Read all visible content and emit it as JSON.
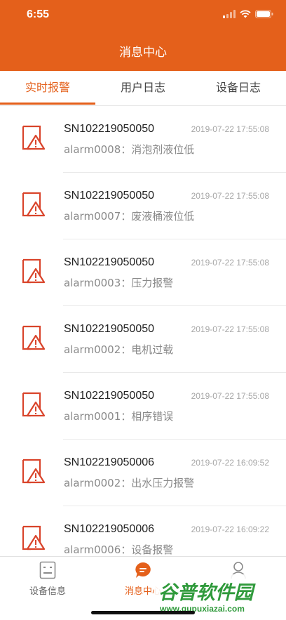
{
  "status": {
    "time": "6:55"
  },
  "nav": {
    "title": "消息中心"
  },
  "tabs": [
    {
      "label": "实时报警",
      "active": true
    },
    {
      "label": "用户日志",
      "active": false
    },
    {
      "label": "设备日志",
      "active": false
    }
  ],
  "alarms": [
    {
      "sn": "SN102219050050",
      "time": "2019-07-22 17:55:08",
      "message": "alarm0008：消泡剂液位低"
    },
    {
      "sn": "SN102219050050",
      "time": "2019-07-22 17:55:08",
      "message": "alarm0007：废液桶液位低"
    },
    {
      "sn": "SN102219050050",
      "time": "2019-07-22 17:55:08",
      "message": "alarm0003：压力报警"
    },
    {
      "sn": "SN102219050050",
      "time": "2019-07-22 17:55:08",
      "message": "alarm0002：电机过载"
    },
    {
      "sn": "SN102219050050",
      "time": "2019-07-22 17:55:08",
      "message": "alarm0001：相序错误"
    },
    {
      "sn": "SN102219050006",
      "time": "2019-07-22 16:09:52",
      "message": "alarm0002：出水压力报警"
    },
    {
      "sn": "SN102219050006",
      "time": "2019-07-22 16:09:22",
      "message": "alarm0006：设备报警"
    }
  ],
  "tabbar": [
    {
      "label": "设备信息",
      "icon": "device-info-icon",
      "active": false
    },
    {
      "label": "消息中心",
      "icon": "message-bubble-icon",
      "active": true
    },
    {
      "label": "",
      "icon": "user-icon",
      "active": false
    }
  ],
  "watermark": {
    "title": "谷普软件园",
    "url": "www.gupuxiazai.com"
  },
  "colors": {
    "accent": "#e4601b",
    "alarm_icon": "#d9442b"
  }
}
